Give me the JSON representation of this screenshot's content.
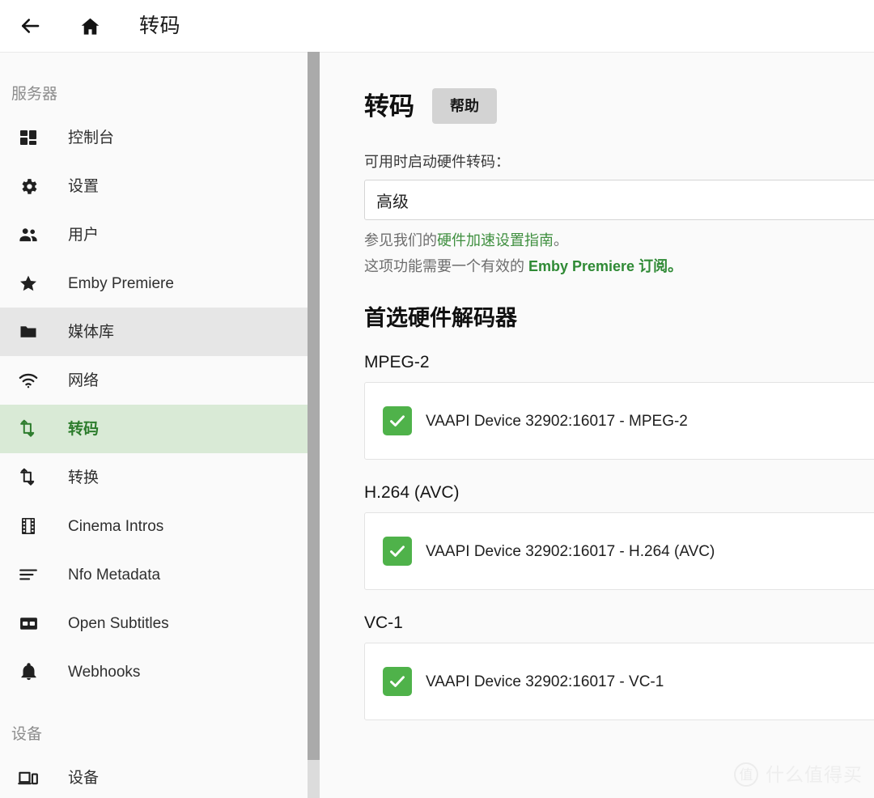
{
  "topbar": {
    "back_icon": "arrow-left-icon",
    "home_icon": "home-icon",
    "title": "转码"
  },
  "sidebar": {
    "sections": [
      {
        "title": "服务器",
        "items": [
          {
            "label": "控制台",
            "icon": "dashboard-icon",
            "state": "normal"
          },
          {
            "label": "设置",
            "icon": "gear-icon",
            "state": "normal"
          },
          {
            "label": "用户",
            "icon": "people-icon",
            "state": "normal"
          },
          {
            "label": "Emby Premiere",
            "icon": "star-icon",
            "state": "normal"
          },
          {
            "label": "媒体库",
            "icon": "folder-icon",
            "state": "hovered"
          },
          {
            "label": "网络",
            "icon": "wifi-icon",
            "state": "normal"
          },
          {
            "label": "转码",
            "icon": "transcode-icon",
            "state": "active"
          },
          {
            "label": "转换",
            "icon": "convert-icon",
            "state": "normal"
          },
          {
            "label": "Cinema Intros",
            "icon": "film-icon",
            "state": "normal"
          },
          {
            "label": "Nfo Metadata",
            "icon": "lines-icon",
            "state": "normal"
          },
          {
            "label": "Open Subtitles",
            "icon": "closed-caption-icon",
            "state": "normal"
          },
          {
            "label": "Webhooks",
            "icon": "bell-icon",
            "state": "normal"
          }
        ]
      },
      {
        "title": "设备",
        "items": [
          {
            "label": "设备",
            "icon": "devices-icon",
            "state": "normal"
          }
        ]
      }
    ],
    "scrollbar": {
      "name": "sidebar-scrollbar"
    }
  },
  "main": {
    "page_title": "转码",
    "help_label": "帮助",
    "hwaccel_field_label": "可用时启动硬件转码：",
    "hwaccel_selected": "高级",
    "hint1_prefix": "参见我们的",
    "hint1_link": "硬件加速设置指南",
    "hint1_suffix": "。",
    "hint2_prefix": "这项功能需要一个有效的 ",
    "hint2_strong": "Emby Premiere",
    "hint2_suffix": " 订阅。",
    "decoder_section_title": "首选硬件解码器",
    "codec_groups": [
      {
        "name": "MPEG-2",
        "options": [
          {
            "label": "VAAPI Device 32902:16017 - MPEG-2",
            "checked": true
          }
        ]
      },
      {
        "name": "H.264 (AVC)",
        "options": [
          {
            "label": "VAAPI Device 32902:16017 - H.264 (AVC)",
            "checked": true
          }
        ]
      },
      {
        "name": "VC-1",
        "options": [
          {
            "label": "VAAPI Device 32902:16017 - VC-1",
            "checked": true
          }
        ]
      }
    ]
  },
  "watermark": {
    "badge": "值",
    "text": "什么值得买"
  },
  "colors": {
    "accent_green": "#4fb24a",
    "active_nav_bg": "#d9ead6",
    "active_nav_text": "#2c7c2c",
    "hover_nav_bg": "#e6e6e6",
    "link_green": "#3f8f3f",
    "panel_bg": "#fafafa",
    "card_bg": "#ffffff"
  }
}
